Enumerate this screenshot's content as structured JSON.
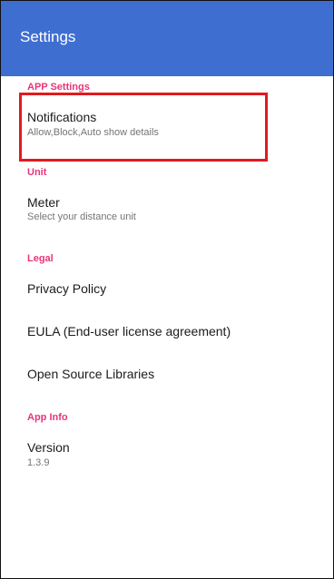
{
  "appbar": {
    "title": "Settings"
  },
  "sections": {
    "app_settings": {
      "header": "APP Settings",
      "notifications": {
        "title": "Notifications",
        "summary": "Allow,Block,Auto show details"
      }
    },
    "unit": {
      "header": "Unit",
      "meter": {
        "title": "Meter",
        "summary": "Select your distance unit"
      }
    },
    "legal": {
      "header": "Legal",
      "privacy": {
        "title": "Privacy Policy"
      },
      "eula": {
        "title": "EULA (End-user license agreement)"
      },
      "oss": {
        "title": "Open Source Libraries"
      }
    },
    "app_info": {
      "header": "App Info",
      "version": {
        "title": "Version",
        "summary": "1.3.9"
      }
    }
  },
  "colors": {
    "appbar": "#3f6ed1",
    "section_header": "#e8357a",
    "highlight_box": "#e3191e"
  }
}
